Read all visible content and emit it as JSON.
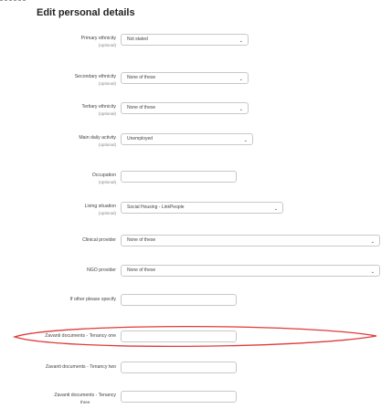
{
  "page": {
    "title": "Edit personal details"
  },
  "fields": [
    {
      "label": "Primary ethnicity",
      "optional": "(optional)",
      "type": "select",
      "value": "Not stated"
    },
    {
      "label": "Secondary ethnicity",
      "optional": "(optional)",
      "type": "select",
      "value": "None of these"
    },
    {
      "label": "Tertiary ethnicity",
      "optional": "(optional)",
      "type": "select",
      "value": "None of these"
    },
    {
      "label": "Main daily activity",
      "optional": "(optional)",
      "type": "select",
      "value": "Unemployed"
    },
    {
      "label": "Occupation",
      "optional": "(optional)",
      "type": "input",
      "value": ""
    },
    {
      "label": "Living situation",
      "optional": "(optional)",
      "type": "select",
      "value": "Social Housing - LinkPeople"
    },
    {
      "label": "Clinical provider",
      "type": "select",
      "value": "None of these"
    },
    {
      "label": "NGO provider",
      "type": "select",
      "value": "None of these"
    },
    {
      "label": "If other please specify",
      "type": "input",
      "value": ""
    },
    {
      "label": "Zavanti documents - Tenancy one",
      "type": "input",
      "value": ""
    },
    {
      "label": "Zavanti documents - Tenancy two",
      "type": "input",
      "value": ""
    },
    {
      "label": "Zavanti documents - Tenancy",
      "extra": "three",
      "type": "input",
      "value": ""
    }
  ],
  "annotation_color": "#e03a3a"
}
